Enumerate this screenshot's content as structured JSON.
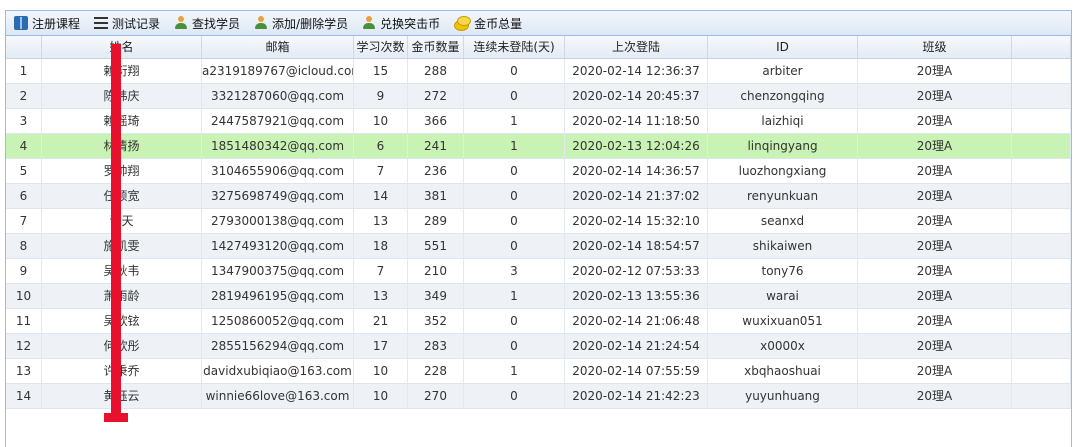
{
  "toolbar": {
    "buttons": [
      {
        "label": "注册课程",
        "icon": "book-icon"
      },
      {
        "label": "测试记录",
        "icon": "list-icon"
      },
      {
        "label": "查找学员",
        "icon": "user-icon"
      },
      {
        "label": "添加/删除学员",
        "icon": "user-icon"
      },
      {
        "label": "兑换突击币",
        "icon": "user-icon"
      },
      {
        "label": "金币总量",
        "icon": "coins-icon"
      }
    ]
  },
  "table": {
    "columns": [
      "",
      "姓名",
      "邮箱",
      "学习次数",
      "金币数量",
      "连续未登陆(天)",
      "上次登陆",
      "ID",
      "班级",
      ""
    ],
    "rows": [
      [
        "1",
        "赖衍翔",
        "a2319189767@icloud.com",
        "15",
        "288",
        "0",
        "2020-02-14 12:36:37",
        "arbiter",
        "20理A"
      ],
      [
        "2",
        "陈炜庆",
        "3321287060@qq.com",
        "9",
        "272",
        "0",
        "2020-02-14 20:45:37",
        "chenzongqing",
        "20理A"
      ],
      [
        "3",
        "赖瑶琦",
        "2447587921@qq.com",
        "10",
        "366",
        "1",
        "2020-02-14 11:18:50",
        "laizhiqi",
        "20理A"
      ],
      [
        "4",
        "林清扬",
        "1851480342@qq.com",
        "6",
        "241",
        "1",
        "2020-02-13 12:04:26",
        "linqingyang",
        "20理A"
      ],
      [
        "5",
        "罗帅翔",
        "3104655906@qq.com",
        "7",
        "236",
        "0",
        "2020-02-14 14:36:57",
        "luozhongxiang",
        "20理A"
      ],
      [
        "6",
        "任颖宽",
        "3275698749@qq.com",
        "14",
        "381",
        "0",
        "2020-02-14 21:37:02",
        "renyunkuan",
        "20理A"
      ],
      [
        "7",
        "谢天",
        "2793000138@qq.com",
        "13",
        "289",
        "0",
        "2020-02-14 15:32:10",
        "seanxd",
        "20理A"
      ],
      [
        "8",
        "施凯雯",
        "1427493120@qq.com",
        "18",
        "551",
        "0",
        "2020-02-14 18:54:57",
        "shikaiwen",
        "20理A"
      ],
      [
        "9",
        "吴秋韦",
        "1347900375@qq.com",
        "7",
        "210",
        "3",
        "2020-02-12 07:53:33",
        "tony76",
        "20理A"
      ],
      [
        "10",
        "萧雨龄",
        "2819496195@qq.com",
        "13",
        "349",
        "1",
        "2020-02-13 13:55:36",
        "warai",
        "20理A"
      ],
      [
        "11",
        "吴欣铉",
        "1250860052@qq.com",
        "21",
        "352",
        "0",
        "2020-02-14 21:06:48",
        "wuxixuan051",
        "20理A"
      ],
      [
        "12",
        "何欣彤",
        "2855156294@qq.com",
        "17",
        "283",
        "0",
        "2020-02-14 21:24:54",
        "x0000x",
        "20理A"
      ],
      [
        "13",
        "许秉乔",
        "davidxubiqiao@163.com",
        "10",
        "228",
        "1",
        "2020-02-14 07:55:59",
        "xbqhaoshuai",
        "20理A"
      ],
      [
        "14",
        "黄钰云",
        "winnie66love@163.com",
        "10",
        "270",
        "0",
        "2020-02-14 21:42:23",
        "yuyunhuang",
        "20理A"
      ]
    ],
    "selected_row": 4
  },
  "colors": {
    "selected_row": "#c9f3b4",
    "alt_row": "#eef2f7",
    "redaction_bar": "#e8112d",
    "border": "#99bbe8"
  }
}
